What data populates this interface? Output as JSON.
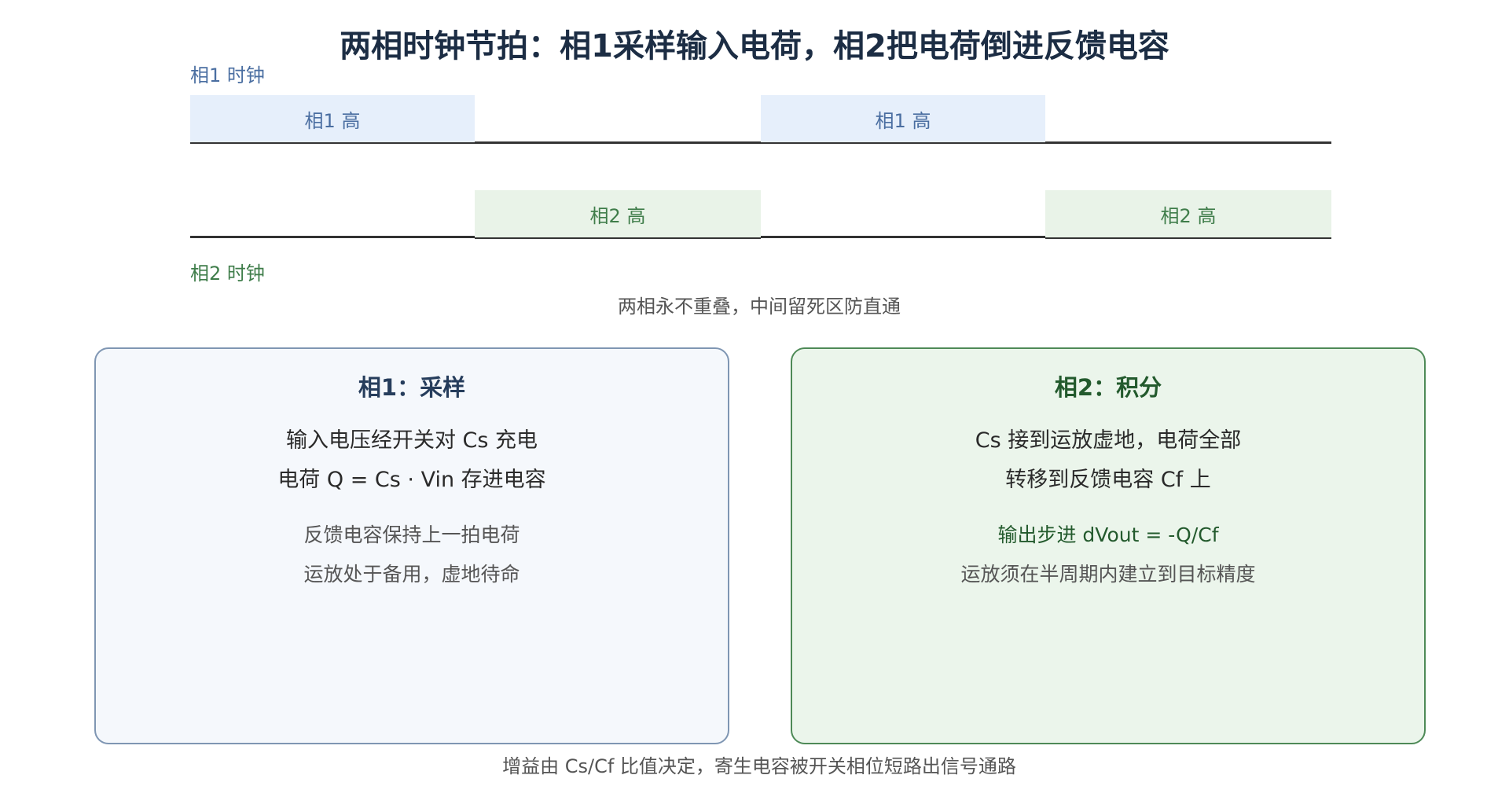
{
  "title": "两相时钟节拍：相1采样输入电荷，相2把电荷倒进反馈电容",
  "clock": {
    "phase1_label": "相1 时钟",
    "phase2_label": "相2 时钟",
    "phase1_high": [
      "相1 高",
      "相1 高"
    ],
    "phase2_high": [
      "相2 高",
      "相2 高"
    ],
    "note": "两相永不重叠，中间留死区防直通"
  },
  "panels": {
    "phase1": {
      "heading": "相1：采样",
      "lines": [
        "输入电压经开关对 Cs 充电",
        "电荷 Q = Cs · Vin 存进电容"
      ],
      "sub": [
        "反馈电容保持上一拍电荷",
        "运放处于备用，虚地待命"
      ]
    },
    "phase2": {
      "heading": "相2：积分",
      "lines": [
        "Cs 接到运放虚地，电荷全部",
        "转移到反馈电容 Cf 上"
      ],
      "highlight": "输出步进 dVout = -Q/Cf",
      "sub": [
        "运放须在半周期内建立到目标精度"
      ]
    }
  },
  "footer": "增益由 Cs/Cf 比值决定，寄生电容被开关相位短路出信号通路"
}
